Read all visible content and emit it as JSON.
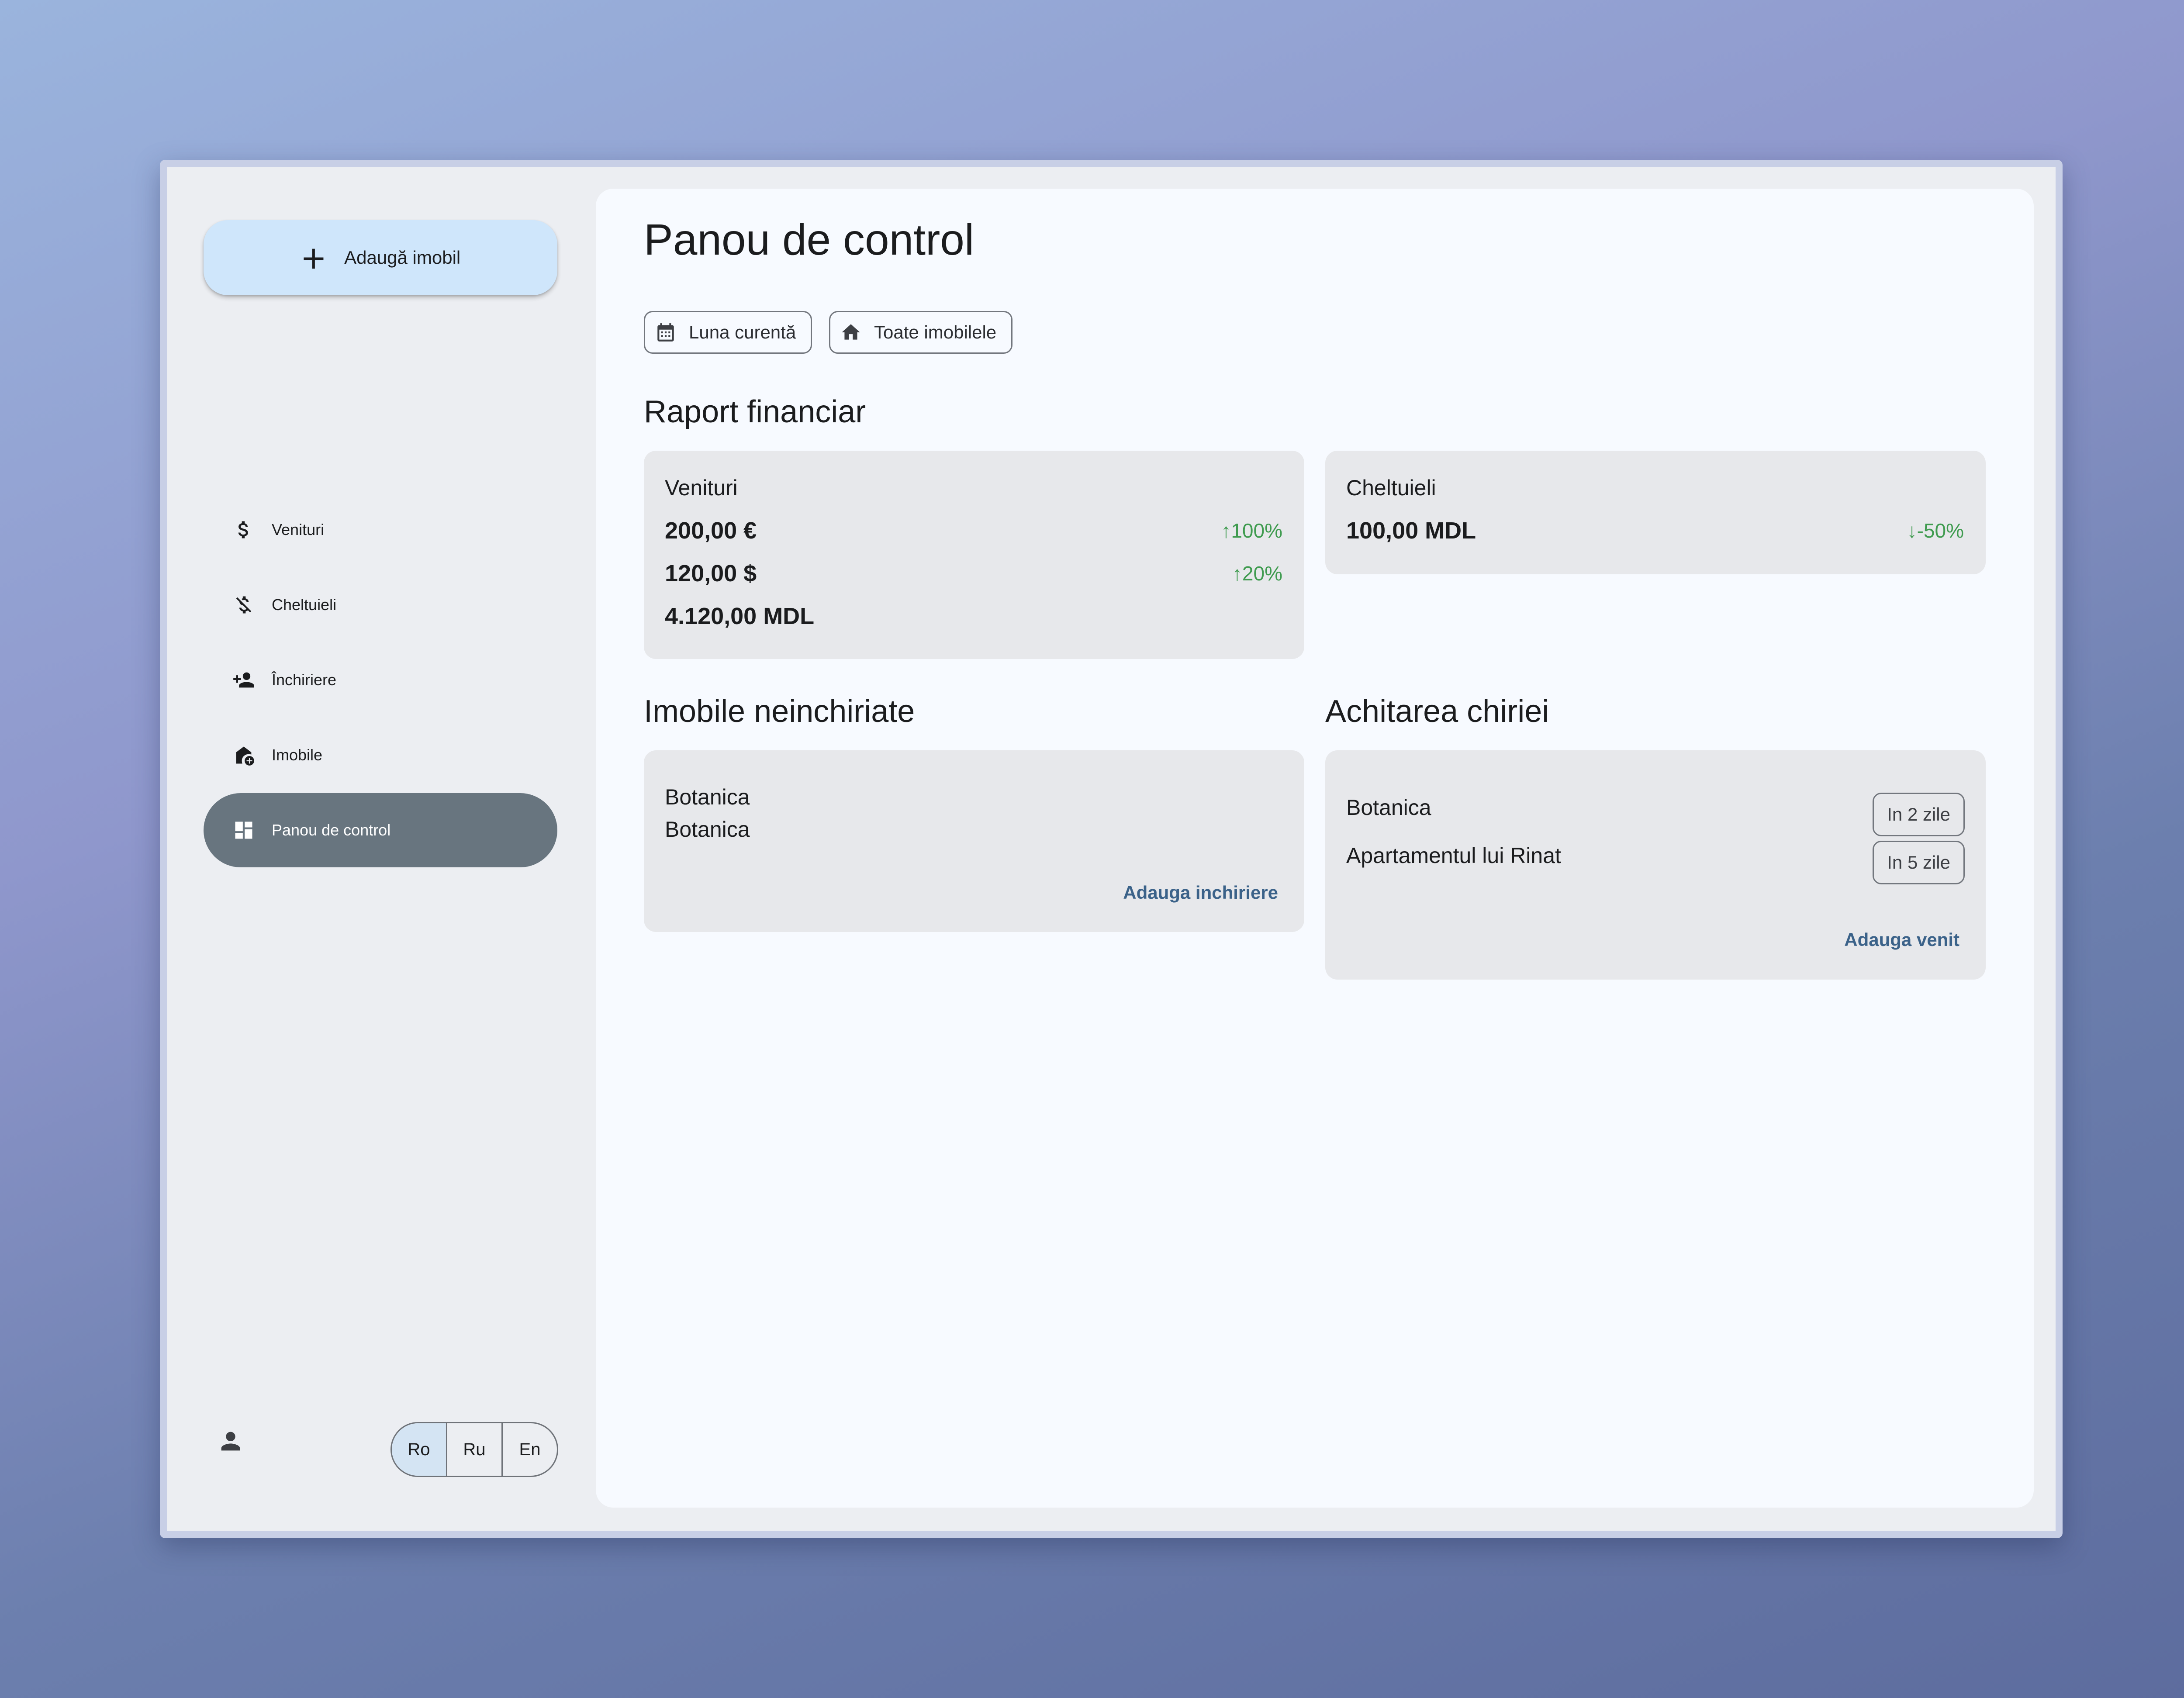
{
  "sidebar": {
    "add_button_label": "Adaugă imobil",
    "items": [
      {
        "label": "Venituri",
        "icon": "dollar-icon"
      },
      {
        "label": "Cheltuieli",
        "icon": "money-off-icon"
      },
      {
        "label": "Închiriere",
        "icon": "person-add-icon"
      },
      {
        "label": "Imobile",
        "icon": "add-home-icon"
      },
      {
        "label": "Panou de control",
        "icon": "dashboard-icon",
        "active": true
      }
    ],
    "user_icon": "person-icon",
    "languages": [
      {
        "label": "Ro",
        "selected": true
      },
      {
        "label": "Ru",
        "selected": false
      },
      {
        "label": "En",
        "selected": false
      }
    ]
  },
  "main": {
    "title": "Panou de control",
    "filters": [
      {
        "label": "Luna curentă",
        "icon": "calendar-icon"
      },
      {
        "label": "Toate imobilele",
        "icon": "home-icon"
      }
    ],
    "financial": {
      "title": "Raport financiar",
      "income": {
        "heading": "Venituri",
        "rows": [
          {
            "amount": "200,00 €",
            "change": "↑100%"
          },
          {
            "amount": "120,00 $",
            "change": "↑20%"
          },
          {
            "amount": "4.120,00 MDL",
            "change": ""
          }
        ]
      },
      "expenses": {
        "heading": "Cheltuieli",
        "rows": [
          {
            "amount": "100,00 MDL",
            "change": "↓-50%"
          }
        ]
      }
    },
    "unrented": {
      "title": "Imobile neinchiriate",
      "items": [
        "Botanica",
        "Botanica"
      ],
      "action_label": "Adauga inchiriere"
    },
    "rent_payment": {
      "title": "Achitarea chiriei",
      "items": [
        {
          "name": "Botanica",
          "due": "In 2 zile"
        },
        {
          "name": "Apartamentul lui Rinat",
          "due": "In 5 zile"
        }
      ],
      "action_label": "Adauga venit"
    }
  },
  "colors": {
    "accent_fab": "#cfe6fb",
    "active_nav": "#68757f",
    "positive_change": "#3f9b4f",
    "link": "#3b6289"
  }
}
